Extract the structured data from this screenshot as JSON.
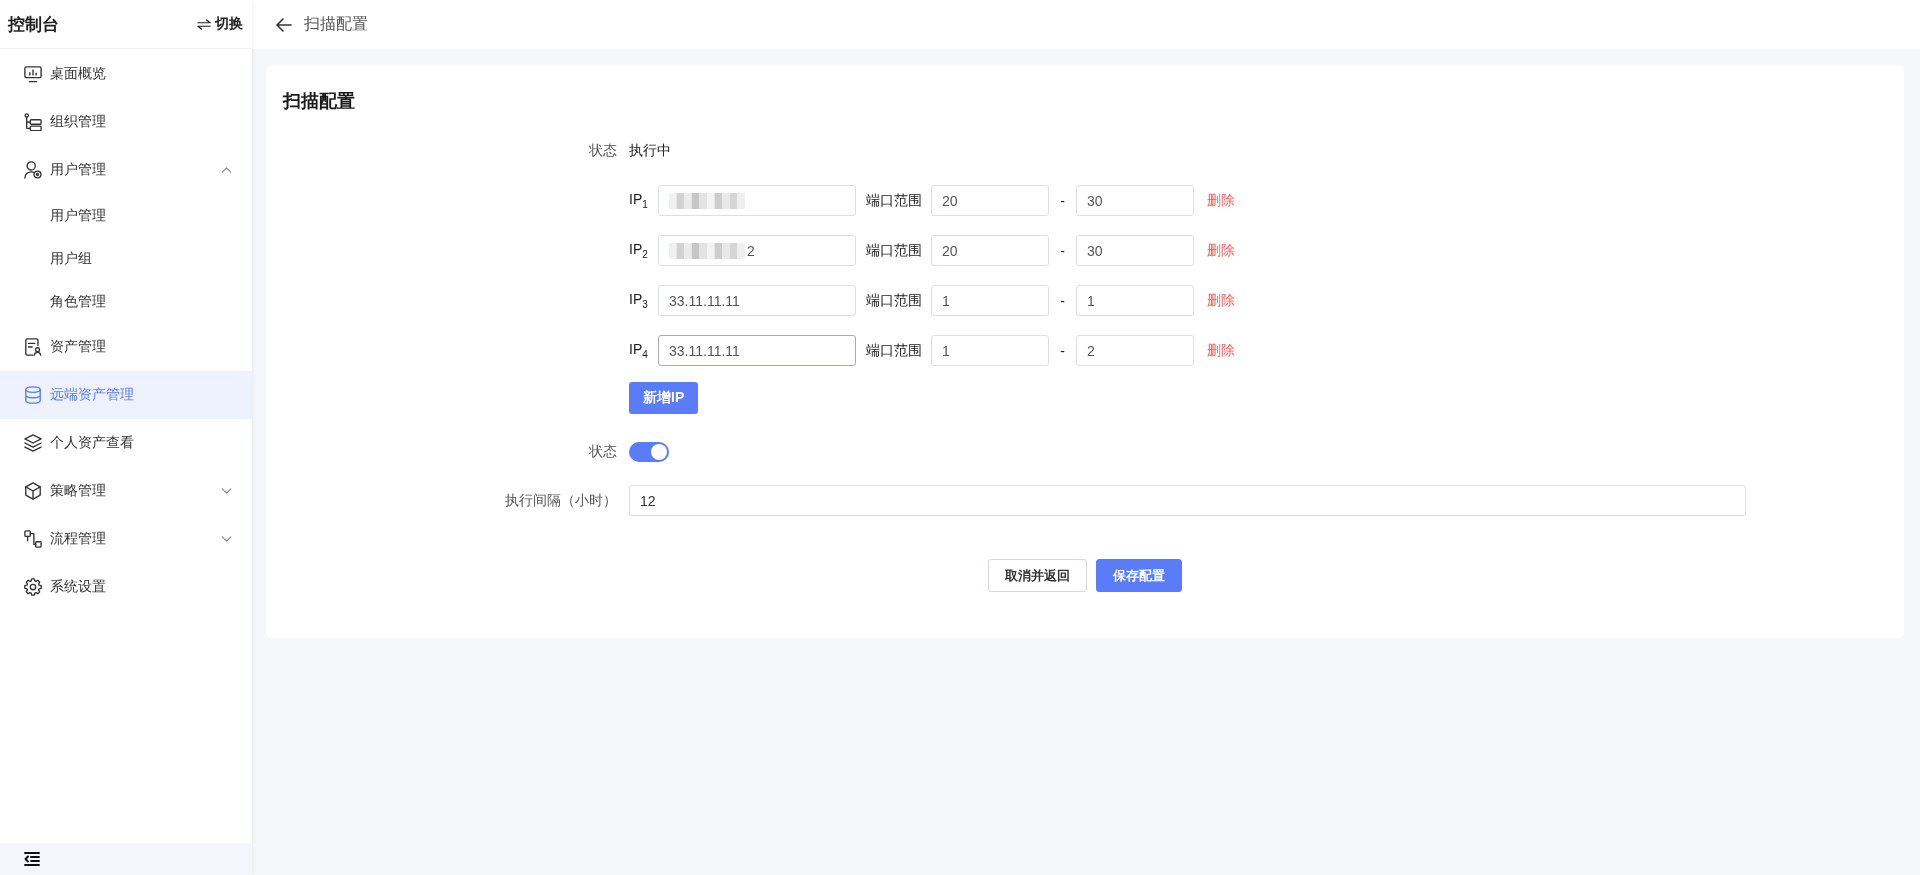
{
  "sidebar": {
    "title": "控制台",
    "switch_label": "切换",
    "menu": [
      {
        "label": "桌面概览",
        "kind": "link",
        "selected": false
      },
      {
        "label": "组织管理",
        "kind": "link",
        "selected": false
      },
      {
        "label": "用户管理",
        "kind": "group",
        "expanded": true,
        "selected": false,
        "children": [
          {
            "label": "用户管理",
            "selected": false
          },
          {
            "label": "用户组",
            "selected": false
          },
          {
            "label": "角色管理",
            "selected": false
          }
        ]
      },
      {
        "label": "资产管理",
        "kind": "link",
        "selected": false
      },
      {
        "label": "远端资产管理",
        "kind": "link",
        "selected": true
      },
      {
        "label": "个人资产查看",
        "kind": "link",
        "selected": false
      },
      {
        "label": "策略管理",
        "kind": "group",
        "expanded": false,
        "selected": false
      },
      {
        "label": "流程管理",
        "kind": "group",
        "expanded": false,
        "selected": false
      },
      {
        "label": "系统设置",
        "kind": "link",
        "selected": false
      }
    ]
  },
  "header": {
    "title": "扫描配置"
  },
  "card": {
    "title": "扫描配置",
    "status": {
      "label": "状态",
      "value": "执行中"
    },
    "ip_rows": [
      {
        "label": "IP$_{1}$",
        "redacted": true,
        "focused": false,
        "port_label": "端口范围",
        "port_from": "20",
        "separator": "-",
        "port_to": "30",
        "delete_label": "删除"
      },
      {
        "label": "IP$_{2}$",
        "ip": "2",
        "redacted": true,
        "focused": false,
        "port_label": "端口范围",
        "port_from": "20",
        "separator": "-",
        "port_to": "30",
        "delete_label": "删除"
      },
      {
        "label": "IP$_{3}$",
        "ip": "33.11.11.11",
        "redacted": false,
        "focused": false,
        "port_label": "端口范围",
        "port_from": "1",
        "separator": "-",
        "port_to": "1",
        "delete_label": "删除"
      },
      {
        "label": "IP$_{4}$",
        "ip": "33.11.11.11",
        "redacted": false,
        "focused": true,
        "port_label": "端口范围",
        "port_from": "1",
        "separator": "-",
        "port_to": "2",
        "delete_label": "删除"
      }
    ],
    "add_button": "新增IP",
    "toggle": {
      "label": "状态",
      "on": true
    },
    "interval": {
      "label": "执行间隔（小时）",
      "value": "12"
    },
    "buttons": [
      {
        "label": "取消并返回",
        "kind": "secondary"
      },
      {
        "label": "保存配置",
        "kind": "primary"
      }
    ]
  }
}
